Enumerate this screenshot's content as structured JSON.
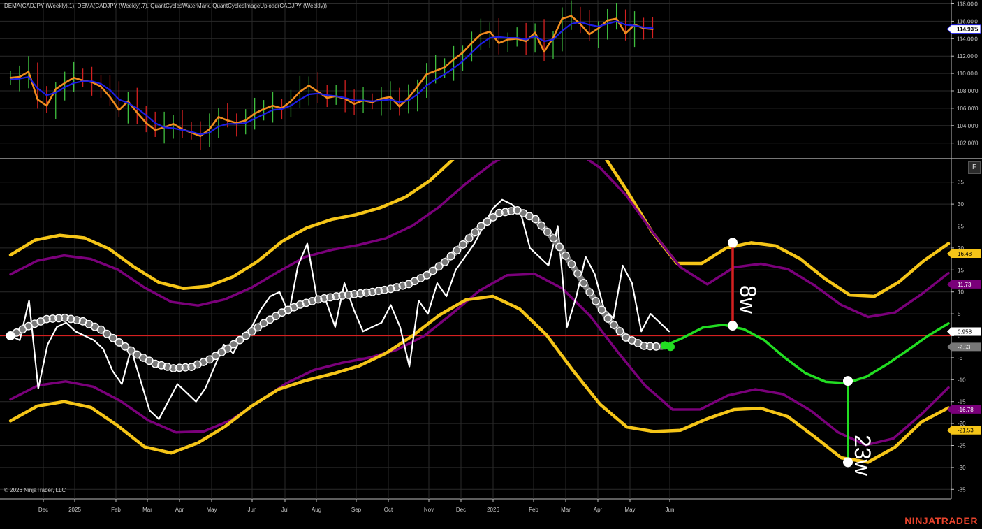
{
  "indicator_title": "DEMA(CADJPY (Weekly),1), DEMA(CADJPY (Weekly),7), QuantCyclesWaterMark, QuantCyclesImageUpload(CADJPY (Weekly))",
  "copyright": "© 2026 NinjaTrader, LLC",
  "brand": "NINJATRADER",
  "panel_button": "F",
  "colors": {
    "background": "#000000",
    "grid": "#2a2a2a",
    "up_bar": "#3fbf3f",
    "down_bar": "#d42020",
    "fast_dema": "#f08c1e",
    "slow_dema": "#1e1ee6",
    "outer_band": "#f5c518",
    "inner_band": "#7a007a",
    "oscillator": "#ffffff",
    "cycle": "#7a7a7a",
    "projection": "#22dd22",
    "zero_line": "#d42020",
    "price_label": "#ffffff"
  },
  "chart_data": [
    {
      "type": "line",
      "title": "",
      "ylim": [
        101,
        118.3
      ],
      "y_ticks": [
        "102.00'0",
        "104.00'0",
        "106.00'0",
        "108.00'0",
        "110.00'0",
        "112.00'0",
        "114.00'0",
        "116.00'0",
        "118.00'0"
      ],
      "x_ticks": [
        "Dec",
        "2025",
        "Feb",
        "Mar",
        "Apr",
        "May",
        "Jun",
        "Jul",
        "Aug",
        "Sep",
        "Oct",
        "Nov",
        "Dec",
        "2026",
        "Feb",
        "Mar",
        "Apr",
        "May",
        "Jun"
      ],
      "last_price_label": "114.93'5",
      "series": [
        {
          "values": [
            109.5,
            109.6,
            110.2,
            107.0,
            106.3,
            108.2,
            108.9,
            109.5,
            109.2,
            109.0,
            108.5,
            107.3,
            105.8,
            106.8,
            105.5,
            104.3,
            103.5,
            103.8,
            104.2,
            103.6,
            103.2,
            102.8,
            103.6,
            105.0,
            104.6,
            104.3,
            104.6,
            105.4,
            105.9,
            106.3,
            106.0,
            106.8,
            107.9,
            108.6,
            107.9,
            107.2,
            107.4,
            107.1,
            106.5,
            106.9,
            106.7,
            107.1,
            107.3,
            106.2,
            107.2,
            108.5,
            109.9,
            110.3,
            110.7,
            111.6,
            112.4,
            113.5,
            114.5,
            114.8,
            113.5,
            113.9,
            114.0,
            113.7,
            114.7,
            112.5,
            114.1,
            116.3,
            116.6,
            115.7,
            114.5,
            115.2,
            116.1,
            116.3,
            114.6,
            115.6,
            115.2,
            115.1
          ]
        },
        {
          "values": [
            109.3,
            109.4,
            109.6,
            108.3,
            107.5,
            107.8,
            108.4,
            108.9,
            109.1,
            109.1,
            108.8,
            108.1,
            107.0,
            106.6,
            106.0,
            105.2,
            104.3,
            103.8,
            103.7,
            103.5,
            103.3,
            103.0,
            103.2,
            103.9,
            104.2,
            104.2,
            104.3,
            104.8,
            105.3,
            105.8,
            105.9,
            106.3,
            107.0,
            107.6,
            107.7,
            107.5,
            107.4,
            107.2,
            106.9,
            106.9,
            106.8,
            106.9,
            107.0,
            106.7,
            106.9,
            107.6,
            108.6,
            109.3,
            109.9,
            110.6,
            111.4,
            112.4,
            113.4,
            114.1,
            114.2,
            114.1,
            114.1,
            113.9,
            114.3,
            113.7,
            113.9,
            114.9,
            115.7,
            115.9,
            115.6,
            115.4,
            115.7,
            116.0,
            115.6,
            115.5,
            115.3,
            115.2
          ]
        }
      ]
    },
    {
      "type": "line",
      "title": "",
      "ylim": [
        -38.6,
        39
      ],
      "y_ticks": [
        "35",
        "30",
        "25",
        "20",
        "15",
        "10",
        "5",
        "0",
        "-5",
        "-10",
        "-15",
        "-20",
        "-25",
        "-30",
        "-35"
      ],
      "x_ticks": [
        "Dec",
        "2025",
        "Feb",
        "Mar",
        "Apr",
        "May",
        "Jun",
        "Jul",
        "Aug",
        "Sep",
        "Oct",
        "Nov",
        "Dec",
        "2026",
        "Feb",
        "Mar",
        "Apr",
        "May",
        "Jun"
      ],
      "annotations": [
        "8w",
        "23w"
      ],
      "value_labels": [
        "16.48",
        "11.73",
        "0.958",
        "-2.53",
        "-16.78",
        "-21.53"
      ],
      "series": [
        {
          "name": "oscillator",
          "values": [
            0,
            -1,
            8,
            -12,
            -2,
            2,
            3,
            1,
            0,
            -1,
            -3,
            -8,
            -11,
            -3,
            -10,
            -17,
            -19,
            -15,
            -11,
            -13,
            -15,
            -12,
            -7,
            -2,
            -4,
            0,
            2,
            6,
            9,
            10,
            5,
            16,
            21,
            9,
            8,
            2,
            12,
            6,
            1,
            2,
            3,
            7,
            2,
            -7,
            8,
            5,
            12,
            9,
            15,
            18,
            21,
            25,
            29,
            31,
            30,
            28,
            20,
            18,
            16,
            25,
            2,
            9,
            18,
            14,
            6,
            4,
            16,
            12,
            1,
            5,
            3,
            1
          ]
        },
        {
          "name": "cycle",
          "values": [
            0,
            2.2,
            3.8,
            4.1,
            3.3,
            1.4,
            -1.5,
            -4.3,
            -6.4,
            -7.4,
            -7.1,
            -5.4,
            -2.9,
            0,
            2.9,
            5.3,
            7.1,
            8.3,
            9.0,
            9.5,
            10.0,
            10.7,
            11.8,
            13.8,
            16.8,
            20.8,
            25.0,
            28.0,
            28.6,
            26.6,
            22.2,
            16.3,
            9.9,
            3.9,
            -0.4,
            -2.3,
            -2.5
          ]
        },
        {
          "name": "projection",
          "values": [
            -2.53,
            -0.5,
            1.9,
            2.5,
            1.5,
            -1.0,
            -5.0,
            -8.5,
            -10.5,
            -10.8,
            -9.3,
            -6.5,
            -3.3,
            0.0,
            2.8
          ]
        },
        {
          "name": "upper_outer",
          "values": [
            18.4,
            21.8,
            22.9,
            22.3,
            19.8,
            15.7,
            12.2,
            10.8,
            11.3,
            13.4,
            16.9,
            21.5,
            24.6,
            26.5,
            27.6,
            29.2,
            31.6,
            35.4,
            40.6,
            45.8,
            50.2,
            52.4,
            51.8,
            48.0,
            41.4,
            32.8,
            23.6,
            16.5,
            16.48,
            20.0,
            21.2,
            20.5,
            17.5,
            13.0,
            9.3,
            9.0,
            12.3,
            17.1,
            21.0
          ]
        },
        {
          "name": "upper_inner",
          "values": [
            14.0,
            17.1,
            18.3,
            17.5,
            15.1,
            11.0,
            7.7,
            6.9,
            8.3,
            11.0,
            14.6,
            18.0,
            19.6,
            20.7,
            22.2,
            25.1,
            29.4,
            34.7,
            39.4,
            42.7,
            43.8,
            42.4,
            38.3,
            31.8,
            23.3,
            15.6,
            11.73,
            15.6,
            16.4,
            15.2,
            11.5,
            7.0,
            4.3,
            5.3,
            9.5,
            14.3
          ]
        },
        {
          "name": "lower_inner",
          "values": [
            -14.5,
            -11.3,
            -10.4,
            -11.6,
            -14.9,
            -19.3,
            -22.0,
            -21.8,
            -19.2,
            -15.0,
            -10.8,
            -7.8,
            -6.2,
            -5.0,
            -3.2,
            0.0,
            5.0,
            10.3,
            13.8,
            14.1,
            10.8,
            4.6,
            -3.6,
            -11.3,
            -16.8,
            -16.78,
            -13.6,
            -12.2,
            -13.3,
            -17.0,
            -22.0,
            -24.9,
            -23.4,
            -18.0,
            -11.8
          ]
        },
        {
          "name": "lower_outer",
          "values": [
            -19.4,
            -16.0,
            -15.0,
            -16.3,
            -20.5,
            -25.3,
            -26.7,
            -24.4,
            -20.7,
            -16.0,
            -12.2,
            -10.2,
            -8.7,
            -6.9,
            -4.0,
            0.0,
            4.7,
            8.2,
            9.0,
            6.1,
            0.2,
            -8.0,
            -15.6,
            -20.8,
            -21.8,
            -21.53,
            -18.9,
            -16.8,
            -16.5,
            -18.4,
            -23.0,
            -27.8,
            -28.8,
            -25.4,
            -19.6,
            -16.4
          ]
        }
      ]
    }
  ]
}
